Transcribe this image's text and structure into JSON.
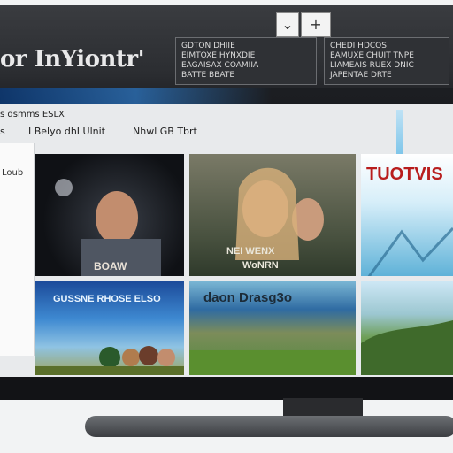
{
  "header": {
    "brand_text": "or InYiontr'",
    "ctrl_left": "⌄",
    "ctrl_right": "+",
    "info_left": [
      "GDTON DHIIE",
      "EIMTOXE HYNXDIE",
      "EAGAISAX COAMIIA",
      "BATTE BBATE"
    ],
    "info_right": [
      "CHEDI HDCOS",
      "EAMUXE CHUIT TNPE",
      "LIAMEAIS RUEX DNIC",
      "JAPENTAE DRTE"
    ]
  },
  "menu": {
    "line1": "s  dsmms  ESLX",
    "line2_items": [
      "s",
      "I  Belyo dhI Ulnit",
      "Nhwl  GB  Tbrt"
    ]
  },
  "sidebar": {
    "label": "Loub"
  },
  "tiles": {
    "t1_caption": "BOAW",
    "t2_caption": "NEI WENX",
    "t2_caption2": "WoNRN",
    "t3_caption": "TUOTVIS",
    "t4_caption": "GUSSNE RHOSE ELSO",
    "t5_caption": "daon Drasg3o",
    "t6_caption": ""
  }
}
